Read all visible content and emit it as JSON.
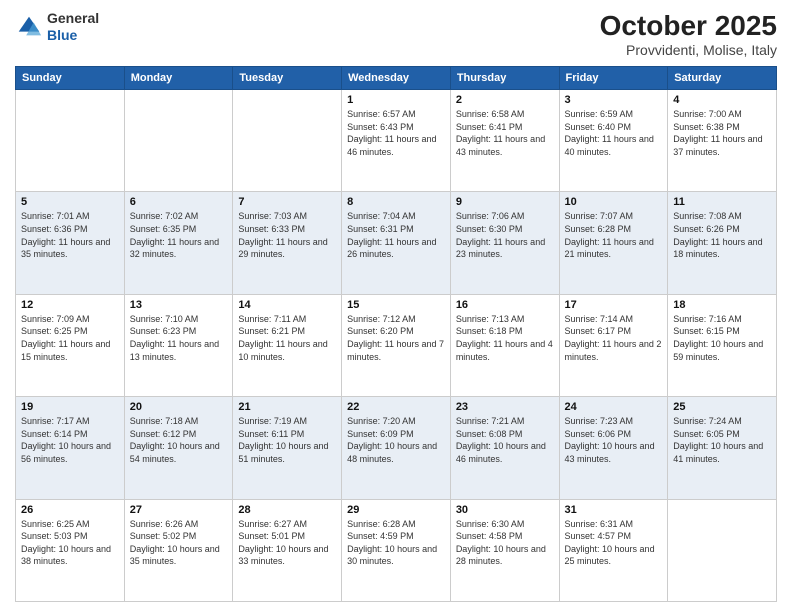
{
  "header": {
    "logo": {
      "line1": "General",
      "line2": "Blue"
    },
    "title": "October 2025",
    "location": "Provvidenti, Molise, Italy"
  },
  "calendar": {
    "days_of_week": [
      "Sunday",
      "Monday",
      "Tuesday",
      "Wednesday",
      "Thursday",
      "Friday",
      "Saturday"
    ],
    "weeks": [
      [
        {
          "day": "",
          "sunrise": "",
          "sunset": "",
          "daylight": ""
        },
        {
          "day": "",
          "sunrise": "",
          "sunset": "",
          "daylight": ""
        },
        {
          "day": "",
          "sunrise": "",
          "sunset": "",
          "daylight": ""
        },
        {
          "day": "1",
          "sunrise": "Sunrise: 6:57 AM",
          "sunset": "Sunset: 6:43 PM",
          "daylight": "Daylight: 11 hours and 46 minutes."
        },
        {
          "day": "2",
          "sunrise": "Sunrise: 6:58 AM",
          "sunset": "Sunset: 6:41 PM",
          "daylight": "Daylight: 11 hours and 43 minutes."
        },
        {
          "day": "3",
          "sunrise": "Sunrise: 6:59 AM",
          "sunset": "Sunset: 6:40 PM",
          "daylight": "Daylight: 11 hours and 40 minutes."
        },
        {
          "day": "4",
          "sunrise": "Sunrise: 7:00 AM",
          "sunset": "Sunset: 6:38 PM",
          "daylight": "Daylight: 11 hours and 37 minutes."
        }
      ],
      [
        {
          "day": "5",
          "sunrise": "Sunrise: 7:01 AM",
          "sunset": "Sunset: 6:36 PM",
          "daylight": "Daylight: 11 hours and 35 minutes."
        },
        {
          "day": "6",
          "sunrise": "Sunrise: 7:02 AM",
          "sunset": "Sunset: 6:35 PM",
          "daylight": "Daylight: 11 hours and 32 minutes."
        },
        {
          "day": "7",
          "sunrise": "Sunrise: 7:03 AM",
          "sunset": "Sunset: 6:33 PM",
          "daylight": "Daylight: 11 hours and 29 minutes."
        },
        {
          "day": "8",
          "sunrise": "Sunrise: 7:04 AM",
          "sunset": "Sunset: 6:31 PM",
          "daylight": "Daylight: 11 hours and 26 minutes."
        },
        {
          "day": "9",
          "sunrise": "Sunrise: 7:06 AM",
          "sunset": "Sunset: 6:30 PM",
          "daylight": "Daylight: 11 hours and 23 minutes."
        },
        {
          "day": "10",
          "sunrise": "Sunrise: 7:07 AM",
          "sunset": "Sunset: 6:28 PM",
          "daylight": "Daylight: 11 hours and 21 minutes."
        },
        {
          "day": "11",
          "sunrise": "Sunrise: 7:08 AM",
          "sunset": "Sunset: 6:26 PM",
          "daylight": "Daylight: 11 hours and 18 minutes."
        }
      ],
      [
        {
          "day": "12",
          "sunrise": "Sunrise: 7:09 AM",
          "sunset": "Sunset: 6:25 PM",
          "daylight": "Daylight: 11 hours and 15 minutes."
        },
        {
          "day": "13",
          "sunrise": "Sunrise: 7:10 AM",
          "sunset": "Sunset: 6:23 PM",
          "daylight": "Daylight: 11 hours and 13 minutes."
        },
        {
          "day": "14",
          "sunrise": "Sunrise: 7:11 AM",
          "sunset": "Sunset: 6:21 PM",
          "daylight": "Daylight: 11 hours and 10 minutes."
        },
        {
          "day": "15",
          "sunrise": "Sunrise: 7:12 AM",
          "sunset": "Sunset: 6:20 PM",
          "daylight": "Daylight: 11 hours and 7 minutes."
        },
        {
          "day": "16",
          "sunrise": "Sunrise: 7:13 AM",
          "sunset": "Sunset: 6:18 PM",
          "daylight": "Daylight: 11 hours and 4 minutes."
        },
        {
          "day": "17",
          "sunrise": "Sunrise: 7:14 AM",
          "sunset": "Sunset: 6:17 PM",
          "daylight": "Daylight: 11 hours and 2 minutes."
        },
        {
          "day": "18",
          "sunrise": "Sunrise: 7:16 AM",
          "sunset": "Sunset: 6:15 PM",
          "daylight": "Daylight: 10 hours and 59 minutes."
        }
      ],
      [
        {
          "day": "19",
          "sunrise": "Sunrise: 7:17 AM",
          "sunset": "Sunset: 6:14 PM",
          "daylight": "Daylight: 10 hours and 56 minutes."
        },
        {
          "day": "20",
          "sunrise": "Sunrise: 7:18 AM",
          "sunset": "Sunset: 6:12 PM",
          "daylight": "Daylight: 10 hours and 54 minutes."
        },
        {
          "day": "21",
          "sunrise": "Sunrise: 7:19 AM",
          "sunset": "Sunset: 6:11 PM",
          "daylight": "Daylight: 10 hours and 51 minutes."
        },
        {
          "day": "22",
          "sunrise": "Sunrise: 7:20 AM",
          "sunset": "Sunset: 6:09 PM",
          "daylight": "Daylight: 10 hours and 48 minutes."
        },
        {
          "day": "23",
          "sunrise": "Sunrise: 7:21 AM",
          "sunset": "Sunset: 6:08 PM",
          "daylight": "Daylight: 10 hours and 46 minutes."
        },
        {
          "day": "24",
          "sunrise": "Sunrise: 7:23 AM",
          "sunset": "Sunset: 6:06 PM",
          "daylight": "Daylight: 10 hours and 43 minutes."
        },
        {
          "day": "25",
          "sunrise": "Sunrise: 7:24 AM",
          "sunset": "Sunset: 6:05 PM",
          "daylight": "Daylight: 10 hours and 41 minutes."
        }
      ],
      [
        {
          "day": "26",
          "sunrise": "Sunrise: 6:25 AM",
          "sunset": "Sunset: 5:03 PM",
          "daylight": "Daylight: 10 hours and 38 minutes."
        },
        {
          "day": "27",
          "sunrise": "Sunrise: 6:26 AM",
          "sunset": "Sunset: 5:02 PM",
          "daylight": "Daylight: 10 hours and 35 minutes."
        },
        {
          "day": "28",
          "sunrise": "Sunrise: 6:27 AM",
          "sunset": "Sunset: 5:01 PM",
          "daylight": "Daylight: 10 hours and 33 minutes."
        },
        {
          "day": "29",
          "sunrise": "Sunrise: 6:28 AM",
          "sunset": "Sunset: 4:59 PM",
          "daylight": "Daylight: 10 hours and 30 minutes."
        },
        {
          "day": "30",
          "sunrise": "Sunrise: 6:30 AM",
          "sunset": "Sunset: 4:58 PM",
          "daylight": "Daylight: 10 hours and 28 minutes."
        },
        {
          "day": "31",
          "sunrise": "Sunrise: 6:31 AM",
          "sunset": "Sunset: 4:57 PM",
          "daylight": "Daylight: 10 hours and 25 minutes."
        },
        {
          "day": "",
          "sunrise": "",
          "sunset": "",
          "daylight": ""
        }
      ]
    ]
  }
}
